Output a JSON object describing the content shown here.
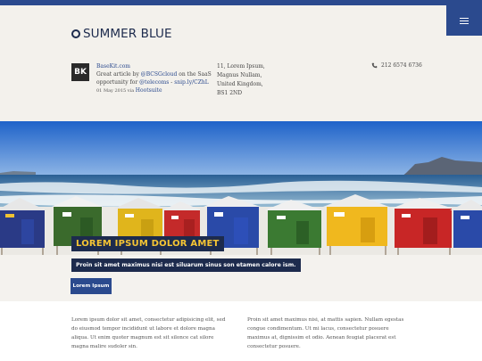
{
  "header": {
    "brand": "SUMMER BLUE",
    "menu_icon": "hamburger-icon"
  },
  "tweet": {
    "avatar_text": "BK",
    "account": "BaseKit.com",
    "text_before": "Great article by ",
    "mention": "@BCSGcloud",
    "text_middle": " on the SaaS opportunity for ",
    "mention2": "@telecoms",
    "text_dash": " - ",
    "link": "snip.ly/CZhL",
    "date": "01 May 2015",
    "via": " via ",
    "via_link": "Hootsuite"
  },
  "address": {
    "line1": "11, Lorem Ipsum,",
    "line2": "Magnus Nullam,",
    "line3": "United Kingdom,",
    "line4": "BS1 2ND"
  },
  "contact": {
    "phone": "212 6574 6736",
    "phone_icon": "phone-icon"
  },
  "hero": {
    "title": "LOREM IPSUM DOLOR AMET",
    "subtitle": "Proin sit amet maximus nisi est siluarum sinus son etamen calore ism.",
    "button": "Lorem Ipsum"
  },
  "content": {
    "col1": "Lorem ipsum dolor sit amet, consectetur adipisicing elit, sed do eiusmod tempor incididunt ut labore et dolore magna aliqua. Ut enim quoter magnum est sit silonce cat silore magna malire sudoler sin.",
    "col2": "Proin sit amet maximus nisi, at mattis sapien. Nullam egestas congue condimentum. Ut mi lacus, consectetur posuere maximus at, dignissim et odio. Aenean feugiat placerat est consectetur posuere."
  }
}
